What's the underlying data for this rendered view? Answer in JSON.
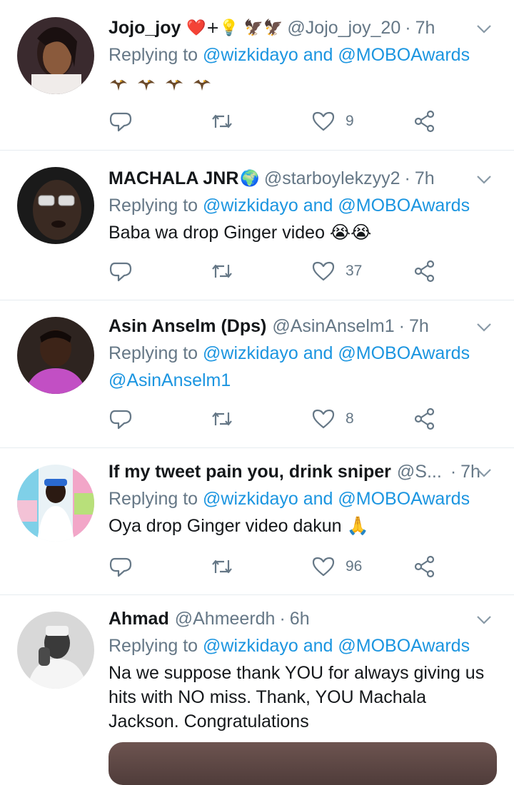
{
  "tweets": [
    {
      "name": "Jojo_joy",
      "name_emoji": "❤️+💡 🦅🦅",
      "handle": "@Jojo_joy_20",
      "time": "7h",
      "replying_prefix": "Replying to",
      "replying_to": "@wizkidayo and @MOBOAwards",
      "text": "",
      "eagles": 4,
      "likes": "9"
    },
    {
      "name": "MACHALA JNR",
      "name_emoji": "🌍",
      "handle": "@starboylekzyy2",
      "time": "7h",
      "replying_prefix": "Replying to",
      "replying_to": "@wizkidayo and @MOBOAwards",
      "text": "Baba wa drop Ginger video 😭😭",
      "likes": "37"
    },
    {
      "name": "Asin Anselm (Dps)",
      "name_emoji": "",
      "handle": "@AsinAnselm1",
      "time": "7h",
      "replying_prefix": "Replying to",
      "replying_to": "@wizkidayo and @MOBOAwards",
      "text": "@AsinAnselm1",
      "likes": "8"
    },
    {
      "name": "If my tweet pain you, drink sniper",
      "name_emoji": "",
      "handle": "@S...",
      "time": "7h",
      "replying_prefix": "Replying to",
      "replying_to": "@wizkidayo and @MOBOAwards",
      "text": "Oya drop Ginger video dakun 🙏",
      "likes": "96"
    },
    {
      "name": "Ahmad",
      "name_emoji": "",
      "handle": "@Ahmeerdh",
      "time": "6h",
      "replying_prefix": "Replying to",
      "replying_to": "@wizkidayo and @MOBOAwards",
      "text": "Na we suppose thank YOU for always giving us hits with NO miss. Thank, YOU Machala Jackson. Congratulations",
      "likes": ""
    }
  ],
  "colors": {
    "link": "#1b95e0",
    "secondary": "#657786",
    "divider": "#e6ecf0",
    "icon": "#657786"
  },
  "icons": [
    "reply-icon",
    "retweet-icon",
    "like-icon",
    "share-icon",
    "chevron-down-icon"
  ]
}
